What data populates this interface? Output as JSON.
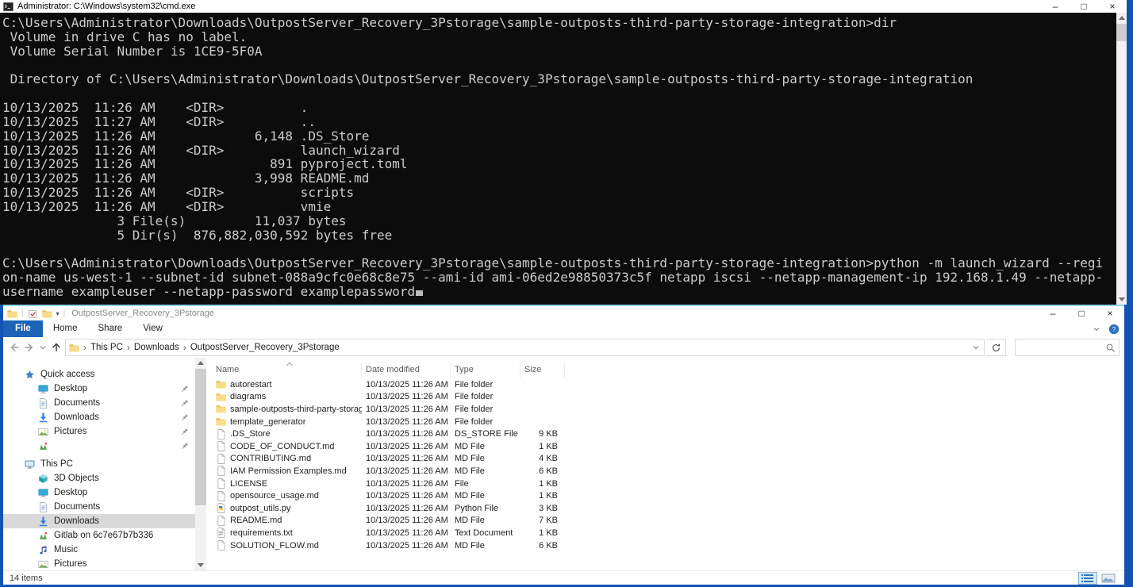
{
  "desktop": {
    "background_color": "#1353b4"
  },
  "cmd_window": {
    "title": "Administrator: C:\\Windows\\system32\\cmd.exe",
    "window_controls": {
      "minimize": "–",
      "maximize": "□",
      "close": "×"
    },
    "console_lines": [
      "C:\\Users\\Administrator\\Downloads\\OutpostServer_Recovery_3Pstorage\\sample-outposts-third-party-storage-integration>dir",
      " Volume in drive C has no label.",
      " Volume Serial Number is 1CE9-5F0A",
      "",
      " Directory of C:\\Users\\Administrator\\Downloads\\OutpostServer_Recovery_3Pstorage\\sample-outposts-third-party-storage-integration",
      "",
      "10/13/2025  11:26 AM    <DIR>          .",
      "10/13/2025  11:27 AM    <DIR>          ..",
      "10/13/2025  11:26 AM             6,148 .DS_Store",
      "10/13/2025  11:26 AM    <DIR>          launch_wizard",
      "10/13/2025  11:26 AM               891 pyproject.toml",
      "10/13/2025  11:26 AM             3,998 README.md",
      "10/13/2025  11:26 AM    <DIR>          scripts",
      "10/13/2025  11:26 AM    <DIR>          vmie",
      "               3 File(s)         11,037 bytes",
      "               5 Dir(s)  876,882,030,592 bytes free",
      "",
      "C:\\Users\\Administrator\\Downloads\\OutpostServer_Recovery_3Pstorage\\sample-outposts-third-party-storage-integration>python -m launch_wizard --region-name us-west-1 --subnet-id subnet-088a9cfc0e68c8e75 --ami-id ami-06ed2e98850373c5f netapp iscsi --netapp-management-ip 192.168.1.49 --netapp-username exampleuser --netapp-password examplepassword"
    ]
  },
  "explorer_window": {
    "title": "OutpostServer_Recovery_3Pstorage",
    "window_controls": {
      "minimize": "–",
      "maximize": "□",
      "close": "×"
    },
    "ribbon_tabs": [
      "File",
      "Home",
      "Share",
      "View"
    ],
    "address_bar": {
      "breadcrumb": [
        "This PC",
        "Downloads",
        "OutpostServer_Recovery_3Pstorage"
      ],
      "search_value": ""
    },
    "sidebar": {
      "sections": [
        {
          "label": "Quick access",
          "icon": "star",
          "children": [
            {
              "label": "Desktop",
              "icon": "desktop",
              "pinned": true
            },
            {
              "label": "Documents",
              "icon": "document",
              "pinned": true
            },
            {
              "label": "Downloads",
              "icon": "download",
              "pinned": true
            },
            {
              "label": "Pictures",
              "icon": "pictures",
              "pinned": true
            },
            {
              "label": "",
              "icon": "gitlab",
              "pinned": true
            }
          ]
        },
        {
          "label": "This PC",
          "icon": "computer",
          "children": [
            {
              "label": "3D Objects",
              "icon": "cube"
            },
            {
              "label": "Desktop",
              "icon": "desktop"
            },
            {
              "label": "Documents",
              "icon": "document"
            },
            {
              "label": "Downloads",
              "icon": "download",
              "selected": true
            },
            {
              "label": "Gitlab on 6c7e67b7b336",
              "icon": "gitlab"
            },
            {
              "label": "Music",
              "icon": "music"
            },
            {
              "label": "Pictures",
              "icon": "pictures"
            }
          ]
        }
      ]
    },
    "file_list": {
      "columns": [
        "Name",
        "Date modified",
        "Type",
        "Size"
      ],
      "sort_column": "Name",
      "rows": [
        {
          "name": "autorestart",
          "date": "10/13/2025 11:26 AM",
          "type": "File folder",
          "size": "",
          "icon": "folder"
        },
        {
          "name": "diagrams",
          "date": "10/13/2025 11:26 AM",
          "type": "File folder",
          "size": "",
          "icon": "folder"
        },
        {
          "name": "sample-outposts-third-party-storage-int...",
          "date": "10/13/2025 11:26 AM",
          "type": "File folder",
          "size": "",
          "icon": "folder"
        },
        {
          "name": "template_generator",
          "date": "10/13/2025 11:26 AM",
          "type": "File folder",
          "size": "",
          "icon": "folder"
        },
        {
          "name": ".DS_Store",
          "date": "10/13/2025 11:26 AM",
          "type": "DS_STORE File",
          "size": "9 KB",
          "icon": "file"
        },
        {
          "name": "CODE_OF_CONDUCT.md",
          "date": "10/13/2025 11:26 AM",
          "type": "MD File",
          "size": "1 KB",
          "icon": "file"
        },
        {
          "name": "CONTRIBUTING.md",
          "date": "10/13/2025 11:26 AM",
          "type": "MD File",
          "size": "4 KB",
          "icon": "file"
        },
        {
          "name": "IAM Permission Examples.md",
          "date": "10/13/2025 11:26 AM",
          "type": "MD File",
          "size": "6 KB",
          "icon": "file"
        },
        {
          "name": "LICENSE",
          "date": "10/13/2025 11:26 AM",
          "type": "File",
          "size": "1 KB",
          "icon": "file"
        },
        {
          "name": "opensource_usage.md",
          "date": "10/13/2025 11:26 AM",
          "type": "MD File",
          "size": "1 KB",
          "icon": "file"
        },
        {
          "name": "outpost_utils.py",
          "date": "10/13/2025 11:26 AM",
          "type": "Python File",
          "size": "3 KB",
          "icon": "python"
        },
        {
          "name": "README.md",
          "date": "10/13/2025 11:26 AM",
          "type": "MD File",
          "size": "7 KB",
          "icon": "file"
        },
        {
          "name": "requirements.txt",
          "date": "10/13/2025 11:26 AM",
          "type": "Text Document",
          "size": "1 KB",
          "icon": "textdoc"
        },
        {
          "name": "SOLUTION_FLOW.md",
          "date": "10/13/2025 11:26 AM",
          "type": "MD File",
          "size": "6 KB",
          "icon": "file"
        }
      ]
    },
    "status_bar": {
      "items_count": "14 items"
    }
  }
}
